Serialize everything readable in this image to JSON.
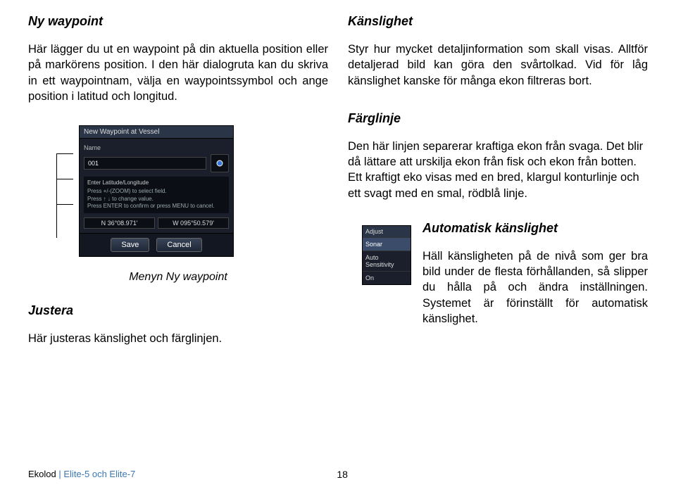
{
  "left": {
    "h1": "Ny waypoint",
    "p1": "Här lägger du ut en waypoint på din aktuella position eller på markörens position. I den här dialogruta kan du skriva in ett waypointnam, välja en waypointssymbol och ange position i latitud och longitud.",
    "caption": "Menyn Ny waypoint",
    "h2": "Justera",
    "p2": "Här justeras känslighet och färglinjen."
  },
  "right": {
    "h1": "Känslighet",
    "p1": "Styr hur mycket detaljinformation som skall visas. Alltför detaljerad bild kan göra den svårtolkad. Vid för låg känslighet kanske för många ekon filtreras bort.",
    "h2": "Färglinje",
    "p2": "Den här linjen separerar kraftiga ekon från svaga. Det blir då lättare att urskilja ekon från fisk och ekon från botten. Ett kraftigt eko visas med en bred, klargul konturlinje och ett svagt med en smal, rödblå linje.",
    "h3": "Automatisk känslighet",
    "p3": "Häll känsligheten på de nivå som ger bra bild under de flesta förhållanden, så slipper du hålla på och ändra inställningen. Systemet är förinställt för automatisk känslighet."
  },
  "shot": {
    "title": "New Waypoint at Vessel",
    "nameLabel": "Name",
    "nameValue": "001",
    "helpLabel": "Enter Latitude/Longitude",
    "help1": "Press +/-(ZOOM) to select field.",
    "help2": "Press ↑ ↓ to change value.",
    "help3": "Press ENTER to confirm or press MENU to cancel.",
    "coordN": "N  36°08.971'",
    "coordW": "W  095°50.579'",
    "save": "Save",
    "cancel": "Cancel"
  },
  "adjshot": {
    "title": "Adjust",
    "i1": "Sonar",
    "i2": "Auto Sensitivity",
    "i3": "On"
  },
  "footer": {
    "section": "Ekolod",
    "model": "Elite-5 och Elite-7",
    "page": "18"
  }
}
